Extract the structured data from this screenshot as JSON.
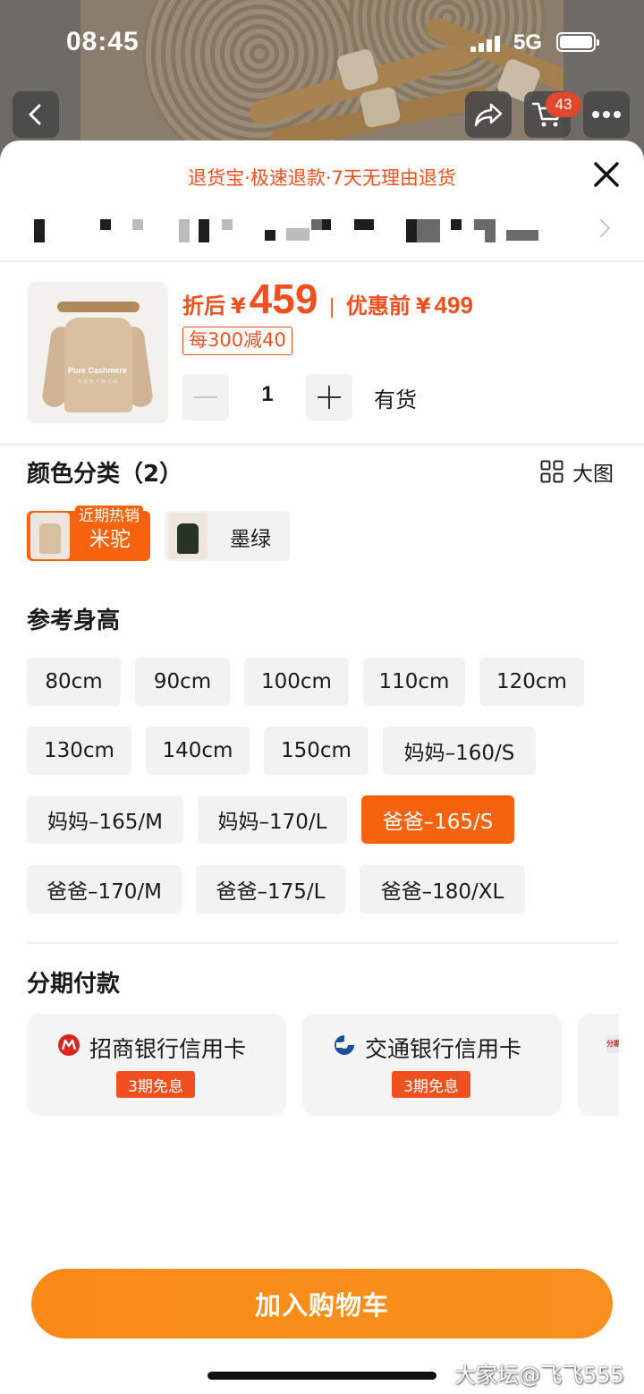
{
  "status_bar": {
    "time": "08:45",
    "network": "5G"
  },
  "nav": {
    "cart_count": "43",
    "icons": [
      "back-arrow-icon",
      "share-icon",
      "cart-icon",
      "more-icon"
    ]
  },
  "sheet": {
    "promo_text": "退货宝·极速退款·7天无理由退货",
    "price": {
      "after_label": "折后",
      "currency": "¥",
      "after_value": "459",
      "separator": "|",
      "before_label": "优惠前",
      "before_value": "499"
    },
    "coupon": "每300减40",
    "product_image": {
      "brand_text": "Pure Cashmere",
      "sub_text": "可 颜 色 可 纯 羊 绒"
    },
    "quantity": {
      "value": "1",
      "stock": "有货"
    },
    "color_section": {
      "title": "颜色分类（2）",
      "big_view_label": "大图",
      "options": [
        {
          "label": "米驼",
          "tag": "近期热销",
          "selected": true,
          "swatch": "#d8bfa0"
        },
        {
          "label": "墨绿",
          "selected": false,
          "swatch": "#263326"
        }
      ]
    },
    "size_section": {
      "title": "参考身高",
      "options": [
        {
          "label": "80cm"
        },
        {
          "label": "90cm"
        },
        {
          "label": "100cm"
        },
        {
          "label": "110cm"
        },
        {
          "label": "120cm"
        },
        {
          "label": "130cm"
        },
        {
          "label": "140cm"
        },
        {
          "label": "150cm"
        },
        {
          "label": "妈妈–160/S"
        },
        {
          "label": "妈妈–165/M"
        },
        {
          "label": "妈妈–170/L"
        },
        {
          "label": "爸爸–165/S",
          "selected": true
        },
        {
          "label": "爸爸–170/M"
        },
        {
          "label": "爸爸–175/L"
        },
        {
          "label": "爸爸–180/XL"
        }
      ]
    },
    "installment": {
      "title": "分期付款",
      "cards": [
        {
          "name": "招商银行信用卡",
          "tag": "3期免息",
          "icon": "cmb-bank-icon"
        },
        {
          "name": "交通银行信用卡",
          "tag": "3期免息",
          "icon": "bocom-bank-icon"
        }
      ],
      "partial_icon_text": "分期"
    },
    "add_to_cart_label": "加入购物车"
  },
  "watermark": "大家坛@飞飞555",
  "colors": {
    "accent": "#f7630c",
    "price": "#f0501f",
    "button": "#f98a18"
  }
}
